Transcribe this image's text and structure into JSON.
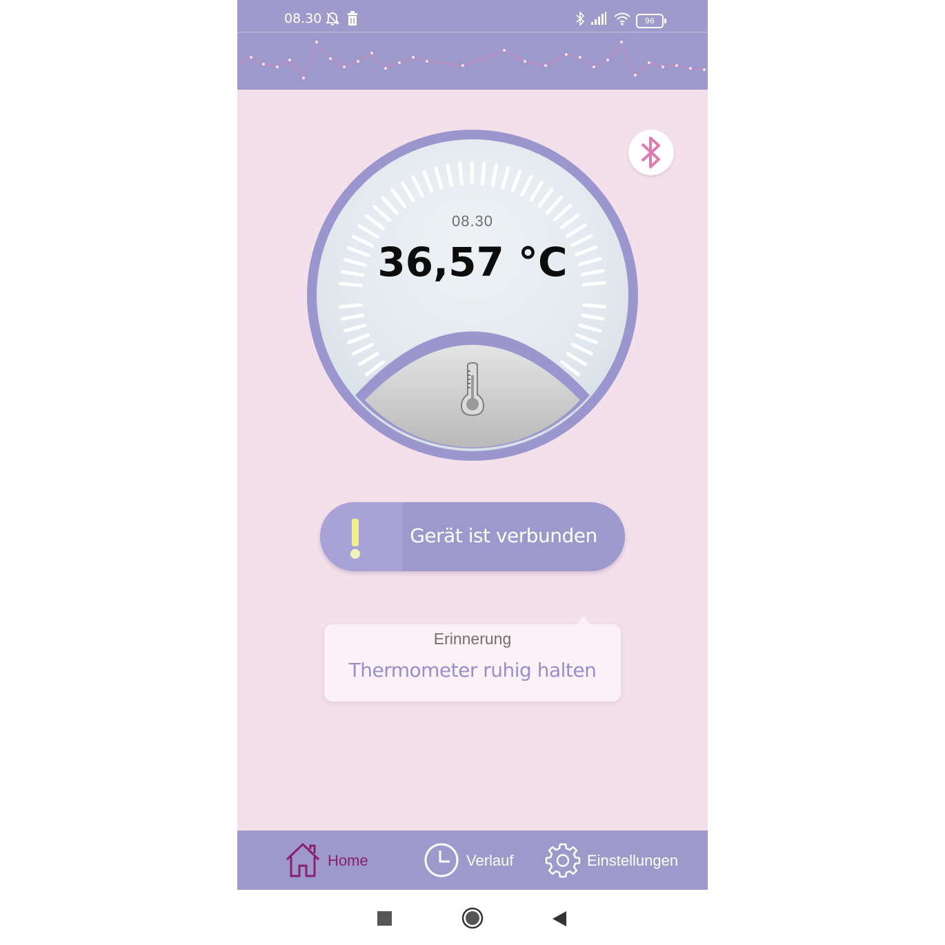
{
  "status_bar": {
    "time": "08.30",
    "icons": [
      "notification-off-icon",
      "trash-icon",
      "bluetooth-icon",
      "signal-icon",
      "wifi-icon"
    ],
    "battery": "96"
  },
  "dial": {
    "time": "08.30",
    "temperature": "36,57 °C",
    "icon": "thermometer-icon"
  },
  "bluetooth_button": {
    "icon": "bluetooth-icon"
  },
  "connection": {
    "status_text": "Gerät ist verbunden",
    "icon": "exclamation-icon"
  },
  "reminder": {
    "title": "Erinnerung",
    "text": "Thermometer ruhig halten"
  },
  "bottom_nav": {
    "items": [
      {
        "label": "Home",
        "icon": "home-icon",
        "active": true
      },
      {
        "label": "Verlauf",
        "icon": "clock-icon",
        "active": false
      },
      {
        "label": "Einstellungen",
        "icon": "gear-icon",
        "active": false
      }
    ]
  },
  "system_nav": {
    "icons": [
      "recents-square-icon",
      "home-circle-icon",
      "back-triangle-icon"
    ]
  },
  "colors": {
    "header_purple": "#9e99cb",
    "background_pink": "#f4e0ea",
    "active_nav": "#8a1f6a",
    "bluetooth_pink": "#e07bb0",
    "exclamation_yellow": "#f0ef8e"
  }
}
